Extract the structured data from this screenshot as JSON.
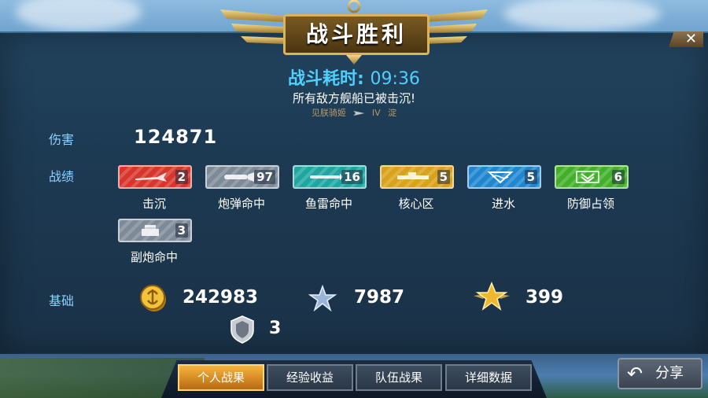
{
  "header": {
    "title": "战斗胜利",
    "close": "✕"
  },
  "battle": {
    "duration_label": "战斗耗时:",
    "duration": "09:36",
    "result_message": "所有敌方舰船已被击沉!",
    "ship_name": "见朕骑姬",
    "ship_tier": "IV",
    "ship_class": "淀"
  },
  "rows": {
    "damage_label": "伤害",
    "record_label": "战绩",
    "basic_label": "基础"
  },
  "damage": "124871",
  "achievements": [
    {
      "label": "击沉",
      "count": "2",
      "color": "#d8352c",
      "icon": "plane-icon"
    },
    {
      "label": "炮弹命中",
      "count": "97",
      "color": "#7d8a98",
      "icon": "shell-icon"
    },
    {
      "label": "鱼雷命中",
      "count": "16",
      "color": "#1fa6a0",
      "icon": "torpedo-icon"
    },
    {
      "label": "核心区",
      "count": "5",
      "color": "#d8a21a",
      "icon": "core-icon"
    },
    {
      "label": "进水",
      "count": "5",
      "color": "#1f86cf",
      "icon": "flood-icon"
    },
    {
      "label": "防御占领",
      "count": "6",
      "color": "#42b02a",
      "icon": "defense-icon"
    },
    {
      "label": "副炮命中",
      "count": "3",
      "color": "#7d8a98",
      "icon": "secondary-gun-icon"
    }
  ],
  "basic": {
    "gold": "242983",
    "stars": "7987",
    "merit": "399",
    "shield": "3"
  },
  "tabs": [
    "个人战果",
    "经验收益",
    "队伍战果",
    "详细数据"
  ],
  "active_tab": 0,
  "share_label": "分享"
}
